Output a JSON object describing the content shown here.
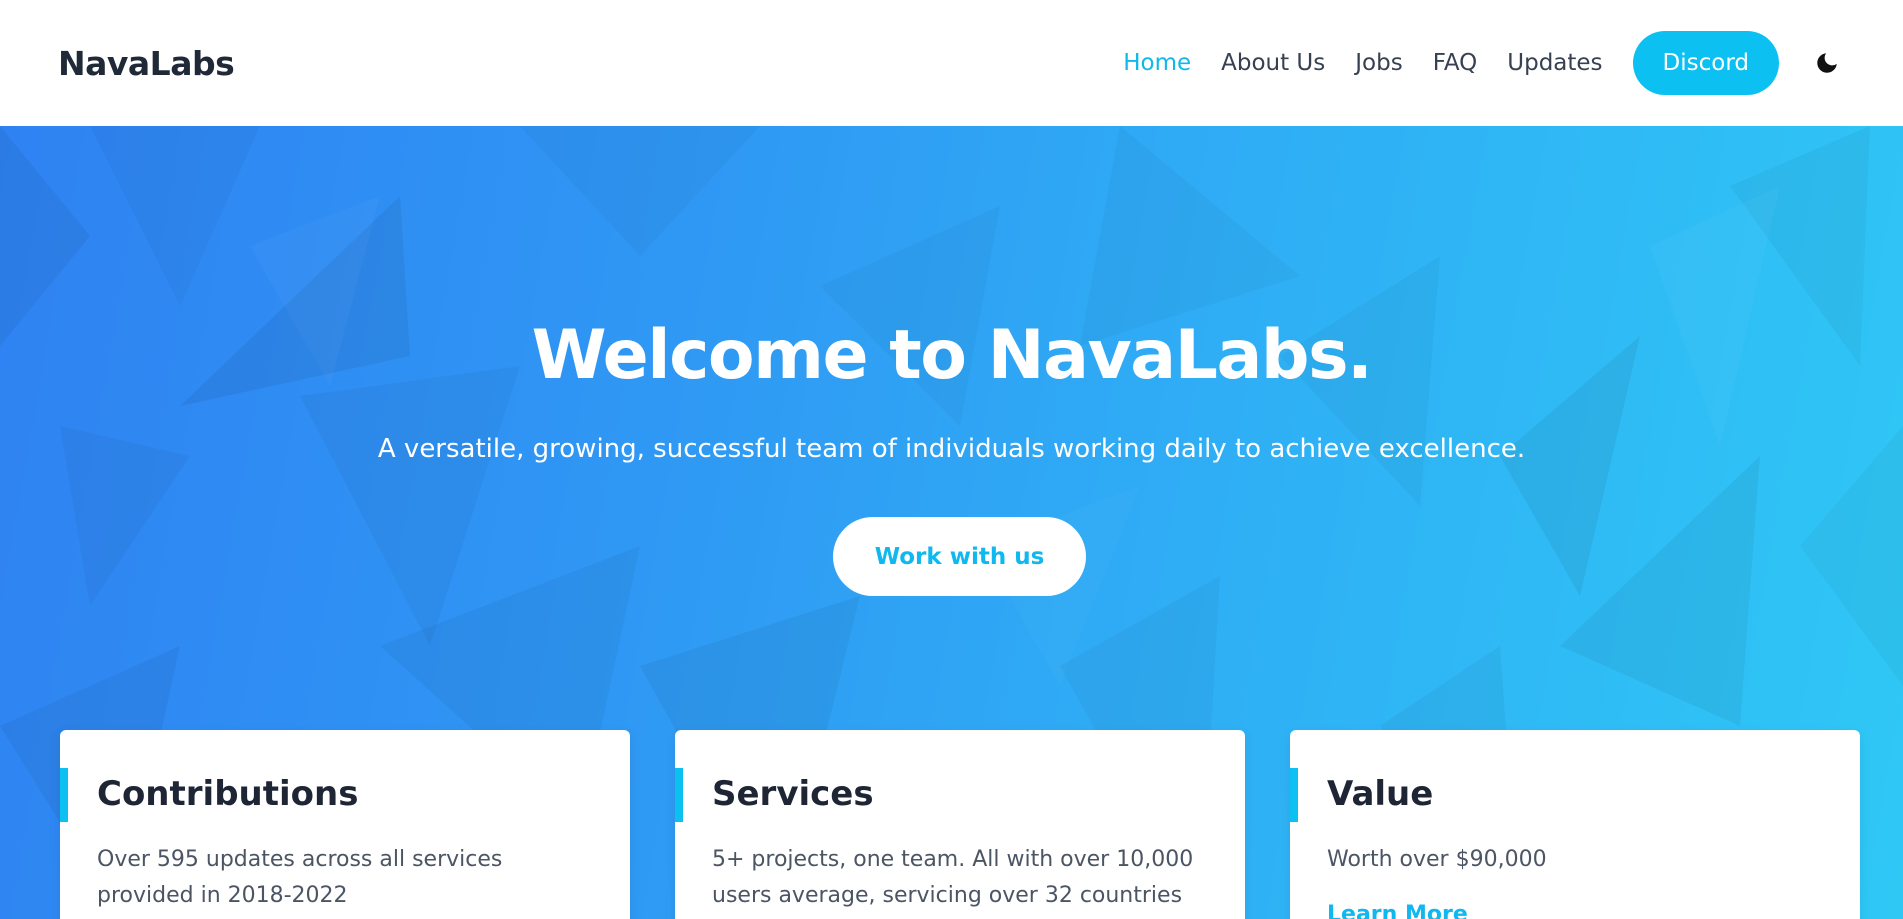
{
  "brand": "NavaLabs",
  "nav": {
    "items": [
      {
        "label": "Home",
        "active": true
      },
      {
        "label": "About Us"
      },
      {
        "label": "Jobs"
      },
      {
        "label": "FAQ"
      },
      {
        "label": "Updates"
      }
    ],
    "discord_label": "Discord",
    "theme_toggle_icon": "moon-icon"
  },
  "hero": {
    "title": "Welcome to NavaLabs.",
    "subtitle": "A versatile, growing, successful team of individuals working daily to achieve excellence.",
    "cta_label": "Work with us"
  },
  "cards": [
    {
      "title": "Contributions",
      "text": "Over 595 updates across all services provided in 2018-2022"
    },
    {
      "title": "Services",
      "text": "5+ projects, one team. All with over 10,000 users average, servicing over 32 countries"
    },
    {
      "title": "Value",
      "text": "Worth over $90,000",
      "link_label": "Learn More"
    }
  ],
  "colors": {
    "accent": "#0cc0f1",
    "hero_gradient_start": "#2f82f2",
    "hero_gradient_end": "#2fc8f5",
    "text_dark": "#1e2535"
  }
}
